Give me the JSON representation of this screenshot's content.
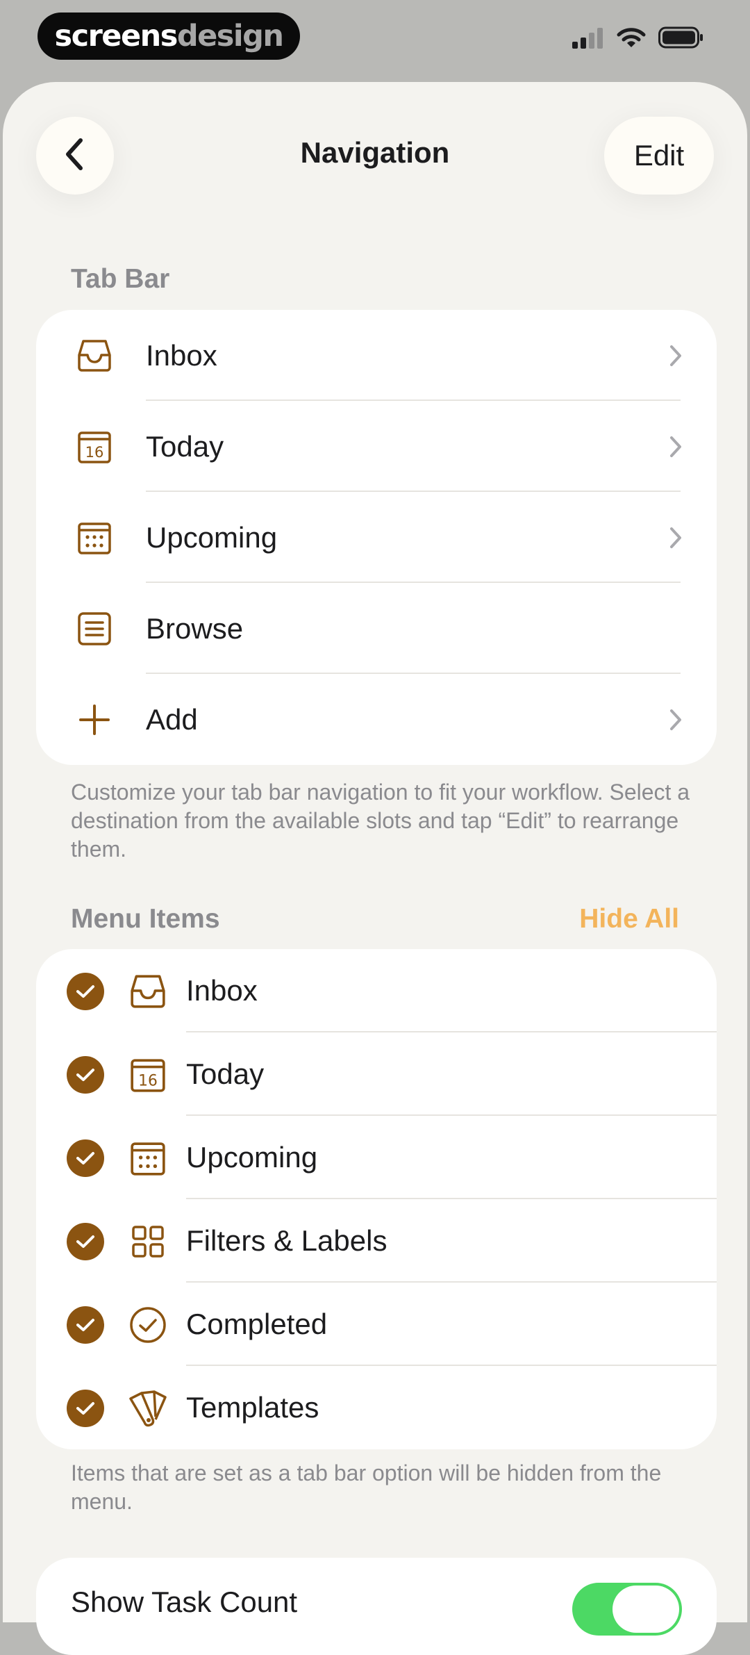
{
  "status_bar": {
    "brand_part_1": "screens",
    "brand_part_2": "design",
    "icons": [
      "cellular-signal-icon",
      "wifi-icon",
      "battery-icon"
    ]
  },
  "header": {
    "back_icon": "chevron-left-icon",
    "title": "Navigation",
    "edit_label": "Edit"
  },
  "tab_bar": {
    "section_title": "Tab Bar",
    "items": [
      {
        "label": "Inbox",
        "icon": "inbox-icon",
        "has_chevron": true
      },
      {
        "label": "Today",
        "icon": "calendar-today-icon",
        "has_chevron": true
      },
      {
        "label": "Upcoming",
        "icon": "calendar-upcoming-icon",
        "has_chevron": true
      },
      {
        "label": "Browse",
        "icon": "browse-list-icon",
        "has_chevron": false
      },
      {
        "label": "Add",
        "icon": "plus-icon",
        "has_chevron": true
      }
    ],
    "footnote": "Customize your tab bar navigation to fit your workflow. Select a destination from the available slots and tap “Edit” to rearrange them."
  },
  "menu_items": {
    "section_title": "Menu Items",
    "hide_all_label": "Hide All",
    "items": [
      {
        "label": "Inbox",
        "icon": "inbox-icon",
        "checked": true
      },
      {
        "label": "Today",
        "icon": "calendar-today-icon",
        "checked": true
      },
      {
        "label": "Upcoming",
        "icon": "calendar-upcoming-icon",
        "checked": true
      },
      {
        "label": "Filters & Labels",
        "icon": "filters-grid-icon",
        "checked": true
      },
      {
        "label": "Completed",
        "icon": "completed-circle-check-icon",
        "checked": true
      },
      {
        "label": "Templates",
        "icon": "templates-swatch-icon",
        "checked": true
      }
    ],
    "footnote": "Items that are set as a tab bar option will be hidden from the menu."
  },
  "show_task_count": {
    "label": "Show Task Count",
    "enabled": true
  },
  "today_icon_number": "16",
  "colors": {
    "accent_brown": "#8b5411",
    "hide_all_orange": "#f3b45b",
    "toggle_green": "#4cd964",
    "background": "#f4f3ef"
  }
}
